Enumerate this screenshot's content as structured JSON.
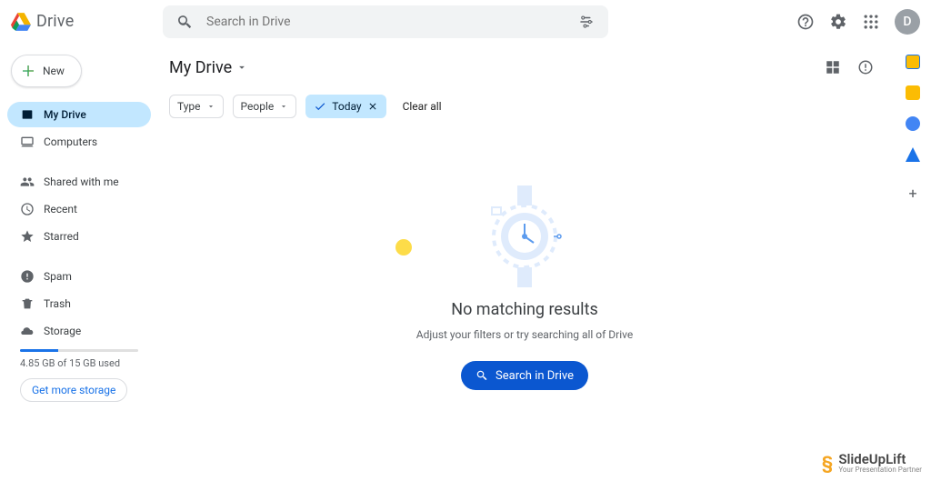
{
  "header": {
    "product": "Drive",
    "search_placeholder": "Search in Drive",
    "avatar_letter": "D"
  },
  "sidebar": {
    "new_label": "New",
    "items": [
      "My Drive",
      "Computers",
      "Shared with me",
      "Recent",
      "Starred",
      "Spam",
      "Trash",
      "Storage"
    ],
    "storage_text": "4.85 GB of 15 GB used",
    "storage_pct": 32,
    "get_more": "Get more storage"
  },
  "main": {
    "title": "My Drive",
    "filters": {
      "type": "Type",
      "people": "People",
      "today": "Today",
      "clear": "Clear all"
    },
    "empty": {
      "title": "No matching results",
      "sub": "Adjust your filters or try searching all of Drive",
      "cta": "Search in Drive"
    }
  },
  "watermark": {
    "title": "SlideUpLift",
    "sub": "Your Presentation Partner"
  }
}
